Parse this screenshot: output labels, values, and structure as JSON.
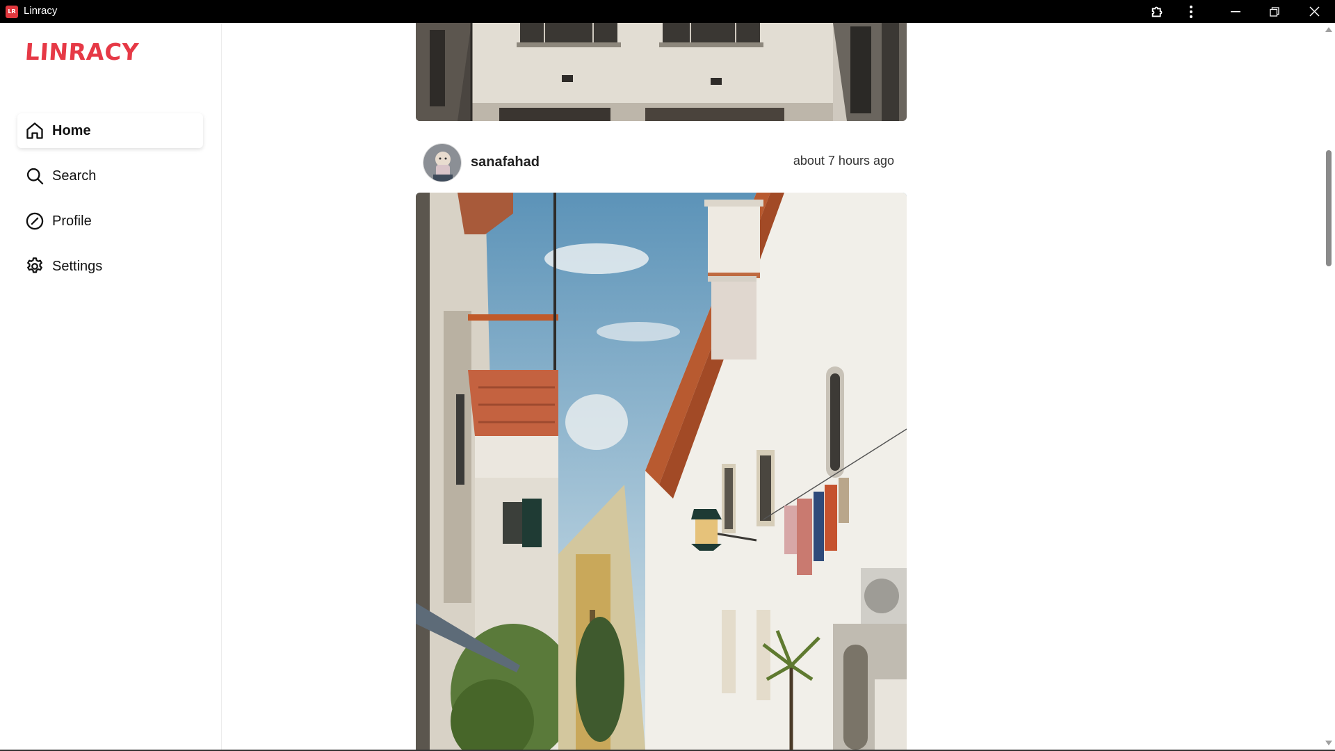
{
  "window": {
    "title": "Linracy",
    "app_icon_text": "LR"
  },
  "sidebar": {
    "logo": "LINRACY",
    "items": [
      {
        "label": "Home",
        "icon": "home-icon",
        "active": true
      },
      {
        "label": "Search",
        "icon": "search-icon",
        "active": false
      },
      {
        "label": "Profile",
        "icon": "compass-icon",
        "active": false
      },
      {
        "label": "Settings",
        "icon": "gear-icon",
        "active": false
      }
    ]
  },
  "feed": {
    "post": {
      "username": "sanafahad",
      "timestamp": "about 7 hours ago"
    }
  },
  "colors": {
    "brand": "#e63946",
    "titlebar": "#000000",
    "text": "#111111"
  }
}
